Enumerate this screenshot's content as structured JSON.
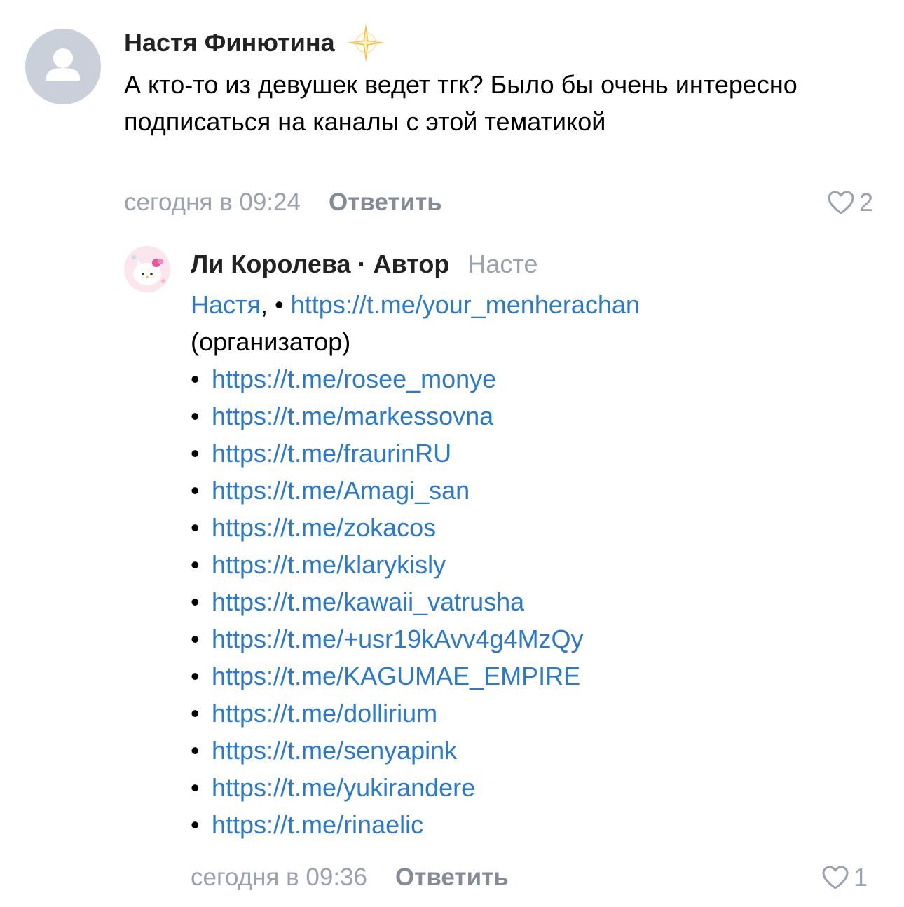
{
  "comments": [
    {
      "author": "Настя Финютина",
      "text": "А кто-то из девушек ведет тгк? Было бы очень интересно подписаться на  каналы с этой тематикой",
      "time": "сегодня в 09:24",
      "reply_label": "Ответить",
      "likes": "2",
      "badge_icon": "sparkle-icon",
      "avatar_icon": "default-user-icon"
    },
    {
      "author": "Ли Королева",
      "separator": "·",
      "role": "Автор",
      "reply_to": "Насте",
      "mention": "Настя",
      "mention_suffix": ",",
      "first_bullet": "•",
      "first_link": "https://t.me/your_menherachan",
      "first_note": "(организатор)",
      "bullet": "•",
      "links": [
        "https://t.me/rosee_monye",
        "https://t.me/markessovna",
        "https://t.me/fraurinRU",
        "https://t.me/Amagi_san",
        "https://t.me/zokacos",
        "https://t.me/klarykisly",
        "https://t.me/kawaii_vatrusha",
        "https://t.me/+usr19kAvv4g4MzQy",
        "https://t.me/KAGUMAE_EMPIRE",
        "https://t.me/dollirium",
        "https://t.me/senyapink",
        "https://t.me/yukirandere",
        "https://t.me/rinaelic"
      ],
      "time": "сегодня в 09:36",
      "reply_label": "Ответить",
      "likes": "1",
      "avatar_icon": "pink-cat-avatar"
    }
  ],
  "colors": {
    "link": "#2a79cf",
    "meta": "#99a2ad",
    "reply_button": "#828b96",
    "author": "#222222"
  },
  "icons": {
    "like": "heart-outline-icon"
  }
}
